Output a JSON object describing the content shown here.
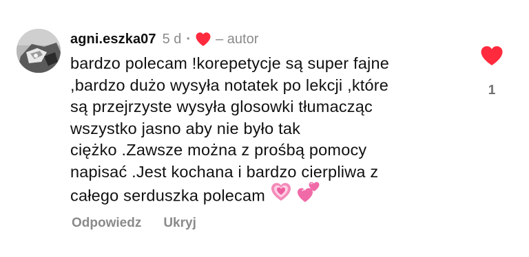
{
  "comment": {
    "username": "agni.eszka07",
    "time_ago": "5 d",
    "separator": "·",
    "author_label": "– autor",
    "text_lines": [
      "bardzo polecam !korepetycje są super fajne",
      ",bardzo dużo wysyła notatek po lekcji ,które",
      "są przejrzyste wysyła glosowki tłumacząc",
      "wszystko jasno aby nie było tak",
      "ciężko .Zawsze można z prośbą pomocy",
      "napisać .Jest kochana i bardzo cierpliwa z",
      "całego serduszka polecam"
    ],
    "emojis": [
      "growing-heart-emoji",
      "two-hearts-emoji"
    ]
  },
  "actions": {
    "reply_label": "Odpowiedz",
    "hide_label": "Ukryj"
  },
  "likes": {
    "count": "1",
    "icon": "heart-filled-icon",
    "liked": true
  },
  "colors": {
    "heart_red": "#ff2a3d",
    "secondary_text": "#8a8a8a",
    "primary_text": "#111111",
    "emoji_pink": "#f06aa8"
  }
}
